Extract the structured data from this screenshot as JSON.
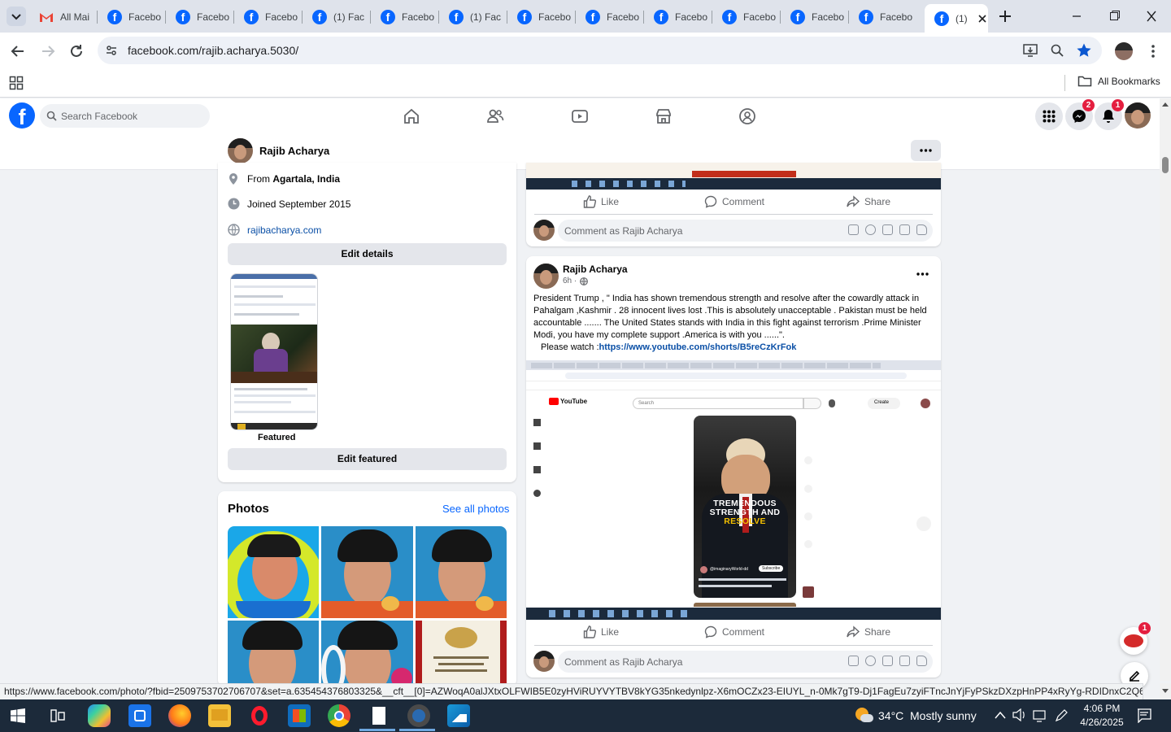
{
  "browser": {
    "tabs": [
      {
        "label": "All Mai",
        "icon": "gmail-icon"
      },
      {
        "label": "Facebo",
        "icon": "facebook-icon"
      },
      {
        "label": "Facebo",
        "icon": "facebook-icon"
      },
      {
        "label": "Facebo",
        "icon": "facebook-icon"
      },
      {
        "label": "(1) Fac",
        "icon": "facebook-icon"
      },
      {
        "label": "Facebo",
        "icon": "facebook-icon"
      },
      {
        "label": "(1) Fac",
        "icon": "facebook-icon"
      },
      {
        "label": "Facebo",
        "icon": "facebook-icon"
      },
      {
        "label": "Facebo",
        "icon": "facebook-icon"
      },
      {
        "label": "Facebo",
        "icon": "facebook-icon"
      },
      {
        "label": "Facebo",
        "icon": "facebook-icon"
      },
      {
        "label": "Facebo",
        "icon": "facebook-icon"
      },
      {
        "label": "Facebo",
        "icon": "facebook-icon"
      },
      {
        "label": "(1)",
        "icon": "facebook-icon"
      }
    ],
    "url": "facebook.com/rajib.acharya.5030/",
    "bookmarks_label": "All Bookmarks",
    "status_url": "https://www.facebook.com/photo/?fbid=2509753702706707&set=a.635454376803325&__cft__[0]=AZWoqA0alJXtxOLFWIB5E0zyHViRUYVYTBV8kYG35nkedynlpz-X6mOCZx23-EIUYL_n-0Mk7gT9-Dj1FagEu7zyiFTncJnYjFyPSkzDXzpHnPP4xRyYg-RDIDnxC2Q6wdq0W..."
  },
  "facebook": {
    "search_placeholder": "Search Facebook",
    "messenger_badge": "2",
    "notifications_badge": "1",
    "profile_name": "Rajib Acharya",
    "intro": {
      "from_prefix": "From ",
      "from_place": "Agartala, India",
      "joined": "Joined September 2015",
      "website": "rajibacharya.com",
      "edit_details": "Edit details",
      "featured_label": "Featured",
      "edit_featured": "Edit featured"
    },
    "photos": {
      "title": "Photos",
      "see_all": "See all photos"
    },
    "top_post": {
      "like": "Like",
      "comment": "Comment",
      "share": "Share",
      "comment_placeholder": "Comment as Rajib Acharya"
    },
    "post": {
      "author": "Rajib Acharya",
      "time": "6h ·",
      "text": "President Trump , \" India has shown tremendous strength and resolve after  the cowardly attack  in Pahalgam ,Kashmir . 28 innocent lives lost .This is absolutely unacceptable . Pakistan must be held accountable ....... The United States stands with India in this  fight against terrorism .Prime Minister Modi, you have my complete support .America is with you ......\".",
      "watch_prefix": "Please watch :",
      "link": "https://www.youtube.com/shorts/B5reCzKrFok",
      "like": "Like",
      "comment": "Comment",
      "share": "Share",
      "comment_placeholder": "Comment as Rajib Acharya",
      "video": {
        "search": "Search",
        "create": "Create",
        "brand": "YouTube",
        "caption": "TREMENDOUS STRENGTH AND",
        "caption_accent": "RESOLVE",
        "channel": "@imaginaryWorld-dd",
        "subscribe": "Subscribe"
      }
    },
    "chat_badge": "1"
  },
  "taskbar": {
    "weather_temp": "34°C",
    "weather_desc": "Mostly sunny",
    "time": "4:06 PM",
    "date": "4/26/2025"
  },
  "colors": {
    "facebook_blue": "#0866ff",
    "badge_red": "#e41e3f",
    "chrome_tabstrip": "#dfe3eb",
    "taskbar": "#1c2a3a"
  }
}
